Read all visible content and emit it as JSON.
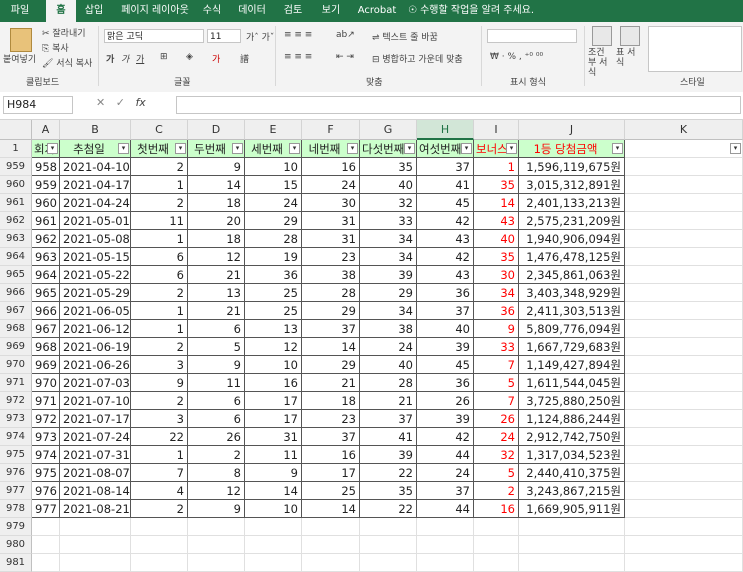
{
  "ribbon_tabs": [
    "파일",
    "홈",
    "삽입",
    "페이지 레이아웃",
    "수식",
    "데이터",
    "검토",
    "보기",
    "Acrobat",
    "수행할 작업을 알려 주세요."
  ],
  "active_tab": "홈",
  "ribbon": {
    "paste": "붙여넣기",
    "cut": "잘라내기",
    "copy": "복사",
    "format_painter": "서식 복사",
    "clipboard": "클립보드",
    "font_name": "맑은 고딕",
    "font_size": "11",
    "font_group": "글꼴",
    "wrap_text": "텍스트 줄 바꿈",
    "merge_center": "병합하고 가운데 맞춤",
    "align_group": "맞춤",
    "number_group": "표시 형식",
    "conditional_format": "조건부 서식",
    "table_format": "표 서식",
    "styles_group": "스타일"
  },
  "name_box": "H984",
  "fx": "fx",
  "columns": [
    "A",
    "B",
    "C",
    "D",
    "E",
    "F",
    "G",
    "H",
    "I",
    "J",
    "K"
  ],
  "header_row": {
    "row_num": "1",
    "cells": [
      "회차",
      "추첨일",
      "첫번째",
      "두번째",
      "세번째",
      "네번째",
      "다섯번째",
      "여섯번째",
      "보너스",
      "1등 당첨금액",
      ""
    ]
  },
  "rows": [
    {
      "num": "959",
      "cells": [
        "958",
        "2021-04-10",
        "2",
        "9",
        "10",
        "16",
        "35",
        "37",
        "1",
        "1,596,119,675원"
      ]
    },
    {
      "num": "960",
      "cells": [
        "959",
        "2021-04-17",
        "1",
        "14",
        "15",
        "24",
        "40",
        "41",
        "35",
        "3,015,312,891원"
      ]
    },
    {
      "num": "961",
      "cells": [
        "960",
        "2021-04-24",
        "2",
        "18",
        "24",
        "30",
        "32",
        "45",
        "14",
        "2,401,133,213원"
      ]
    },
    {
      "num": "962",
      "cells": [
        "961",
        "2021-05-01",
        "11",
        "20",
        "29",
        "31",
        "33",
        "42",
        "43",
        "2,575,231,209원"
      ]
    },
    {
      "num": "963",
      "cells": [
        "962",
        "2021-05-08",
        "1",
        "18",
        "28",
        "31",
        "34",
        "43",
        "40",
        "1,940,906,094원"
      ]
    },
    {
      "num": "964",
      "cells": [
        "963",
        "2021-05-15",
        "6",
        "12",
        "19",
        "23",
        "34",
        "42",
        "35",
        "1,476,478,125원"
      ]
    },
    {
      "num": "965",
      "cells": [
        "964",
        "2021-05-22",
        "6",
        "21",
        "36",
        "38",
        "39",
        "43",
        "30",
        "2,345,861,063원"
      ]
    },
    {
      "num": "966",
      "cells": [
        "965",
        "2021-05-29",
        "2",
        "13",
        "25",
        "28",
        "29",
        "36",
        "34",
        "3,403,348,929원"
      ]
    },
    {
      "num": "967",
      "cells": [
        "966",
        "2021-06-05",
        "1",
        "21",
        "25",
        "29",
        "34",
        "37",
        "36",
        "2,411,303,513원"
      ]
    },
    {
      "num": "968",
      "cells": [
        "967",
        "2021-06-12",
        "1",
        "6",
        "13",
        "37",
        "38",
        "40",
        "9",
        "5,809,776,094원"
      ]
    },
    {
      "num": "969",
      "cells": [
        "968",
        "2021-06-19",
        "2",
        "5",
        "12",
        "14",
        "24",
        "39",
        "33",
        "1,667,729,683원"
      ]
    },
    {
      "num": "970",
      "cells": [
        "969",
        "2021-06-26",
        "3",
        "9",
        "10",
        "29",
        "40",
        "45",
        "7",
        "1,149,427,894원"
      ]
    },
    {
      "num": "971",
      "cells": [
        "970",
        "2021-07-03",
        "9",
        "11",
        "16",
        "21",
        "28",
        "36",
        "5",
        "1,611,544,045원"
      ]
    },
    {
      "num": "972",
      "cells": [
        "971",
        "2021-07-10",
        "2",
        "6",
        "17",
        "18",
        "21",
        "26",
        "7",
        "3,725,880,250원"
      ]
    },
    {
      "num": "973",
      "cells": [
        "972",
        "2021-07-17",
        "3",
        "6",
        "17",
        "23",
        "37",
        "39",
        "26",
        "1,124,886,244원"
      ]
    },
    {
      "num": "974",
      "cells": [
        "973",
        "2021-07-24",
        "22",
        "26",
        "31",
        "37",
        "41",
        "42",
        "24",
        "2,912,742,750원"
      ]
    },
    {
      "num": "975",
      "cells": [
        "974",
        "2021-07-31",
        "1",
        "2",
        "11",
        "16",
        "39",
        "44",
        "32",
        "1,317,034,523원"
      ]
    },
    {
      "num": "976",
      "cells": [
        "975",
        "2021-08-07",
        "7",
        "8",
        "9",
        "17",
        "22",
        "24",
        "5",
        "2,440,410,375원"
      ]
    },
    {
      "num": "977",
      "cells": [
        "976",
        "2021-08-14",
        "4",
        "12",
        "14",
        "25",
        "35",
        "37",
        "2",
        "3,243,867,215원"
      ]
    },
    {
      "num": "978",
      "cells": [
        "977",
        "2021-08-21",
        "2",
        "9",
        "10",
        "14",
        "22",
        "44",
        "16",
        "1,669,905,911원"
      ]
    }
  ],
  "empty_rows": [
    "979",
    "980",
    "981"
  ],
  "colors": {
    "accent": "#217346",
    "header_fill": "#ccffcc",
    "bonus": "#ff0000"
  }
}
